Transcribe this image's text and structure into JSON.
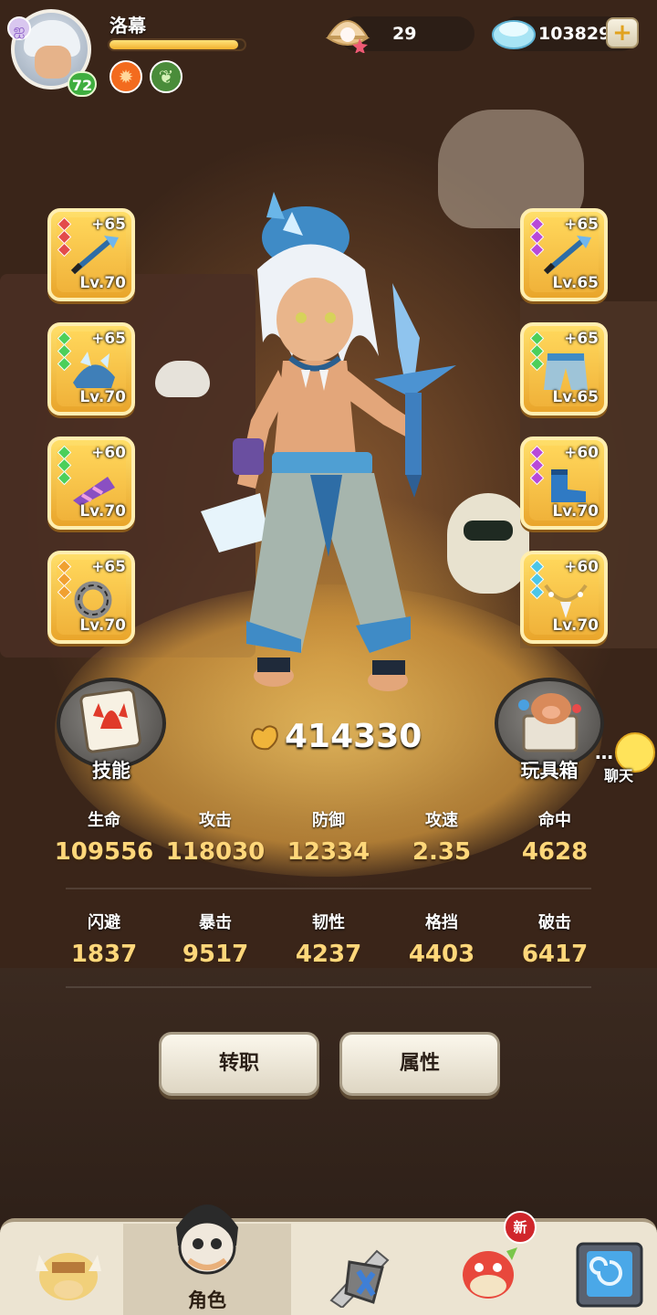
{
  "player": {
    "name": "洛幕",
    "level": "72",
    "exp_fraction": 0.95
  },
  "resources": {
    "pearls": "29",
    "gems": "103829"
  },
  "equipment": {
    "left": [
      {
        "plus": "+65",
        "level": "Lv.70",
        "gems": [
          "#e34b4b",
          "#e34b4b",
          "#e34b4b"
        ],
        "icon": "spear-icon"
      },
      {
        "plus": "+65",
        "level": "Lv.70",
        "gems": [
          "#4ccf5a",
          "#4ccf5a",
          "#4ccf5a"
        ],
        "icon": "helmet-icon"
      },
      {
        "plus": "+60",
        "level": "Lv.70",
        "gems": [
          "#4ccf5a",
          "#4ccf5a",
          "#4ccf5a"
        ],
        "icon": "bracer-icon"
      },
      {
        "plus": "+65",
        "level": "Lv.70",
        "gems": [
          "#f0a030",
          "#f0a030",
          "#f0a030"
        ],
        "icon": "ring-icon"
      }
    ],
    "right": [
      {
        "plus": "+65",
        "level": "Lv.65",
        "gems": [
          "#b84ad8",
          "#b84ad8",
          "#b84ad8"
        ],
        "icon": "spear-icon"
      },
      {
        "plus": "+65",
        "level": "Lv.65",
        "gems": [
          "#4ccf5a",
          "#4ccf5a",
          "#4ccf5a"
        ],
        "icon": "pants-icon"
      },
      {
        "plus": "+60",
        "level": "Lv.70",
        "gems": [
          "#b84ad8",
          "#b84ad8",
          "#b84ad8"
        ],
        "icon": "boots-icon"
      },
      {
        "plus": "+60",
        "level": "Lv.70",
        "gems": [
          "#4cc6e8",
          "#4cc6e8",
          "#4cc6e8"
        ],
        "icon": "necklace-icon"
      }
    ]
  },
  "buttons": {
    "skills": "技能",
    "toybox": "玩具箱",
    "chat": "聊天",
    "job_change": "转职",
    "attributes": "属性"
  },
  "power": "414330",
  "stats": [
    {
      "name": "生命",
      "value": "109556"
    },
    {
      "name": "攻击",
      "value": "118030"
    },
    {
      "name": "防御",
      "value": "12334"
    },
    {
      "name": "攻速",
      "value": "2.35"
    },
    {
      "name": "命中",
      "value": "4628"
    },
    {
      "name": "闪避",
      "value": "1837"
    },
    {
      "name": "暴击",
      "value": "9517"
    },
    {
      "name": "韧性",
      "value": "4237"
    },
    {
      "name": "格挡",
      "value": "4403"
    },
    {
      "name": "破击",
      "value": "6417"
    }
  ],
  "nav": {
    "role_label": "角色",
    "new_badge": "新"
  }
}
